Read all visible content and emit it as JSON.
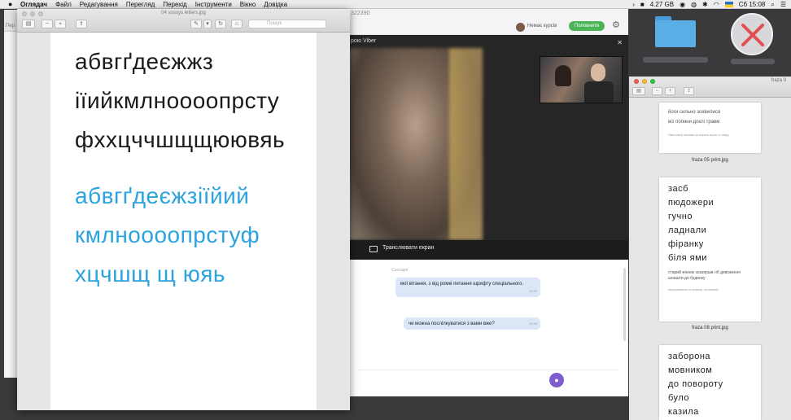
{
  "menubar": {
    "apple": "",
    "app_name": "Оглядач",
    "items": [
      "Файл",
      "Редагування",
      "Перегляд",
      "Перехід",
      "Інструменти",
      "Вікно",
      "Довідка"
    ],
    "storage": "4.27 GB",
    "time": "Сб 15:08"
  },
  "preview_letters": {
    "title": "04 sosuys letters.jpg",
    "search_placeholder": "Пошук",
    "black_lines": [
      "абвгґдеєжжз",
      "іїийкмлноооопрсту",
      "фхxцччшщщюювяь"
    ],
    "blue_lines": [
      "абвгґдеєжзіїйий",
      "кмлноооопрстуф",
      "хцчшщ щ юяь"
    ]
  },
  "back_window": {
    "label": "Пер"
  },
  "viber": {
    "phone": "322390",
    "status": "Немає курсів",
    "call_button": "Поповнити",
    "video_header": "рою Viber",
    "cast_label": "Транслювати екран",
    "date_label": "Сьогодні",
    "messages": [
      {
        "text": "мої вітання, з від ромкі питання шрифту спеціального.",
        "time": "14:55"
      },
      {
        "text": "чи можна послілкуватися з вами вже?",
        "time": "14:56"
      }
    ]
  },
  "fraza": {
    "title": "fraza 0",
    "thumb1": {
      "lines": [
        "йоги сильно зоявилися",
        "всі попини доклі травм"
      ],
      "small": "Гава нияня ласиква на сижала ксуна, тс пекру"
    },
    "thumb1_caption": "fraza 05 print.jpg",
    "thumb2": {
      "words": [
        "засб",
        "пюдожери",
        "гучно",
        "ладнали",
        "фіранку",
        "біля ями"
      ],
      "small": "старий жінник сказяршв нб дивізикння шоашти до будинку",
      "tiny": "вирькувазкини за гомсиця тиц виалкрі"
    },
    "thumb2_caption": "fraza 08 print.jpg",
    "thumb3": {
      "words": [
        "заборона",
        "мовником",
        "до повороту",
        "було",
        "казила"
      ]
    }
  }
}
